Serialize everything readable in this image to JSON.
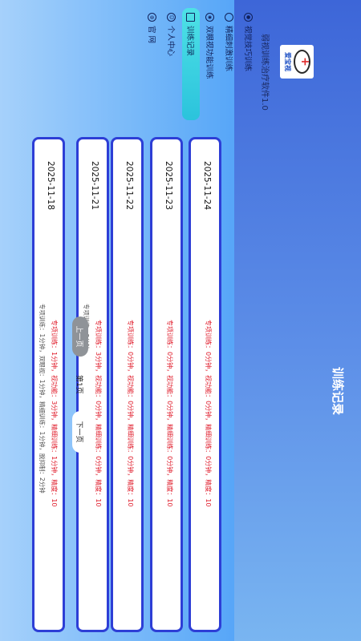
{
  "sidebar": {
    "logo_text": "爱宝视",
    "subtitle": "弱视训练治疗软件1.0",
    "items": [
      {
        "label": "视觉技巧训练",
        "icon": "dot-icon",
        "active": false
      },
      {
        "label": "精细刺激训练",
        "icon": "circle-icon",
        "active": false
      },
      {
        "label": "双眼视功能训练",
        "icon": "eye-icon",
        "active": false
      },
      {
        "label": "训练记录",
        "icon": "record-icon",
        "active": true
      },
      {
        "label": "个人中心",
        "icon": "user-icon",
        "active": false
      },
      {
        "label": "官 网",
        "icon": "globe-icon",
        "active": false
      }
    ]
  },
  "main": {
    "title": "训练记录",
    "records": [
      {
        "date": "2025-11-24",
        "line1": "专项训练：0分钟，视功能：0分钟，精细训练：0分钟，精度：10",
        "line2": ""
      },
      {
        "date": "2025-11-23",
        "line1": "专项训练：0分钟，视功能：0分钟，精细训练：0分钟，精度：10",
        "line2": ""
      },
      {
        "date": "2025-11-22",
        "line1": "专项训练：0分钟，视功能：0分钟，精细训练：0分钟，精度：10",
        "line2": ""
      },
      {
        "date": "2025-11-21",
        "line1": "专项训练：3分钟，视功能：0分钟，精细训练：0分钟，精度：10",
        "line2": "专项训练：3分钟"
      },
      {
        "date": "2025-11-18",
        "line1": "专项训练：1分钟，视功能：3分钟，精细训练：1分钟，精度：10",
        "line2": "专项训练：1分钟，双眼视：1分钟，精细训练：1分钟，脱抑制：2分钟"
      }
    ],
    "pager": {
      "prev_label": "上一页",
      "page_label": "第1页",
      "next_label": "下一页"
    }
  },
  "colors": {
    "card_border": "#2d3ed6",
    "highlight_text": "#e01b2a",
    "active_nav": "#4ee1e6"
  }
}
